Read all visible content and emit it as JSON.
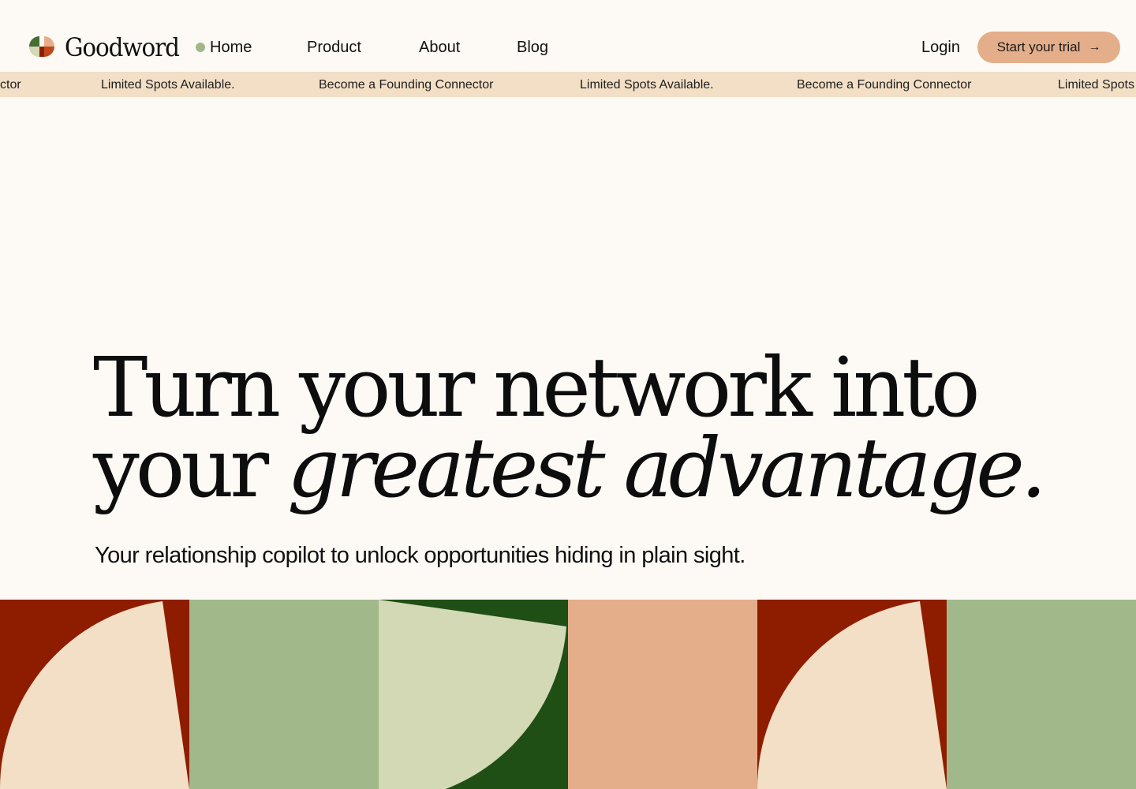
{
  "brand": {
    "name": "Goodword",
    "colors": {
      "cream": "#fdfaf5",
      "sand": "#f2dfc5",
      "peach": "#e3ae89",
      "sage": "#a1b98a",
      "pale_sage": "#d3d9b5",
      "forest": "#204f16",
      "rust": "#8e1d00"
    }
  },
  "nav": {
    "items": [
      {
        "label": "Home",
        "active": true
      },
      {
        "label": "Product"
      },
      {
        "label": "About"
      },
      {
        "label": "Blog"
      }
    ],
    "login_label": "Login",
    "cta": {
      "label": "Start your trial",
      "icon": "arrow-right-icon"
    }
  },
  "marquee": {
    "items": [
      "ctor",
      "Limited Spots Available.",
      "Become a Founding Connector",
      "Limited Spots Available.",
      "Become a Founding Connector",
      "Limited Spots"
    ]
  },
  "hero": {
    "title_line1": "Turn your network into",
    "title_line2_start": "your ",
    "title_line2_emphasis": "greatest advantage.",
    "subtitle": "Your relationship copilot to unlock opportunities hiding in plain sight."
  },
  "art_tiles": [
    {
      "background": "#8e1d00",
      "shape_color": "#f2dfc5",
      "shape": "quarter-fan-left"
    },
    {
      "background": "#a1b98a",
      "shape": "none"
    },
    {
      "background": "#204f16",
      "shape_color": "#d3d9b5",
      "shape": "quarter-fan-right"
    },
    {
      "background": "#e3ae89",
      "shape": "none"
    },
    {
      "background": "#8e1d00",
      "shape_color": "#f2dfc5",
      "shape": "quarter-fan-left"
    },
    {
      "background": "#a1b98a",
      "shape": "none"
    }
  ]
}
